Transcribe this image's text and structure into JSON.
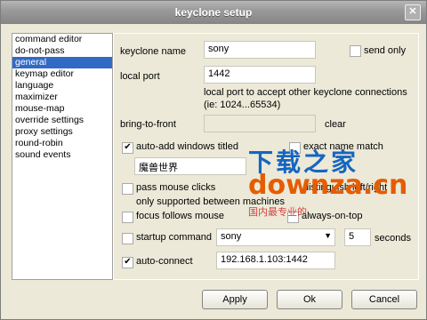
{
  "window": {
    "title": "keyclone setup",
    "close_glyph": "✕"
  },
  "sidebar": {
    "items": [
      {
        "label": "command editor"
      },
      {
        "label": "do-not-pass"
      },
      {
        "label": "general"
      },
      {
        "label": "keymap editor"
      },
      {
        "label": "language"
      },
      {
        "label": "maximizer"
      },
      {
        "label": "mouse-map"
      },
      {
        "label": "override settings"
      },
      {
        "label": "proxy settings"
      },
      {
        "label": "round-robin"
      },
      {
        "label": "sound events"
      }
    ],
    "selected": "general"
  },
  "general": {
    "keyclone_name": {
      "label": "keyclone name",
      "value": "sony"
    },
    "send_only": {
      "label": "send only",
      "checked": false
    },
    "local_port": {
      "label": "local port",
      "value": "1442",
      "hint_line1": "local port to accept other keyclone connections",
      "hint_line2": "(ie: 1024...65534)"
    },
    "bring_to_front": {
      "label": "bring-to-front",
      "value": "",
      "clear_label": "clear"
    },
    "auto_add": {
      "label": "auto-add windows titled",
      "checked": true,
      "value": "魔兽世界"
    },
    "exact_name_match": {
      "label": "exact name match",
      "checked": false
    },
    "pass_mouse_clicks": {
      "label": "pass mouse clicks",
      "checked": false,
      "note": "only supported between machines"
    },
    "distinguish": {
      "label": "distinguish left/right"
    },
    "focus_follows_mouse": {
      "label": "focus follows mouse",
      "checked": false
    },
    "always_on_top": {
      "label": "always-on-top",
      "checked": false
    },
    "startup_command": {
      "label": "startup command",
      "checked": false,
      "value": "sony",
      "seconds_value": "5",
      "seconds_label": "seconds"
    },
    "auto_connect": {
      "label": "auto-connect",
      "checked": true,
      "value": "192.168.1.103:1442"
    }
  },
  "watermark": {
    "line1": "下载之家",
    "line2": "downza.cn",
    "line3": "国内最专业的"
  },
  "buttons": {
    "apply": "Apply",
    "ok": "Ok",
    "cancel": "Cancel"
  },
  "check_glyph": "✔",
  "arrow_glyph": "▼"
}
